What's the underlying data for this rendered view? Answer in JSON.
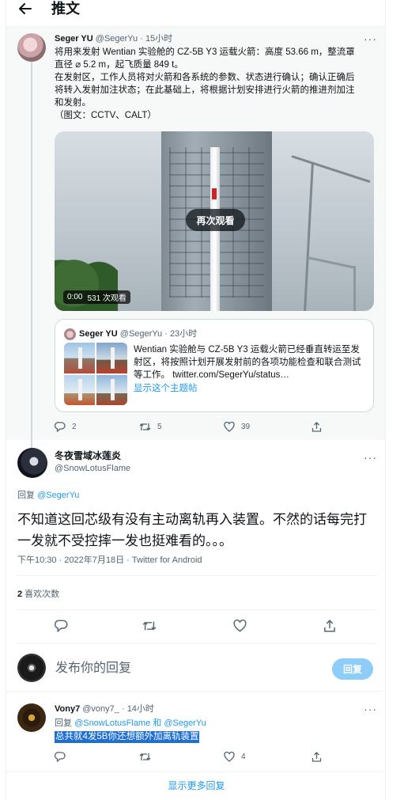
{
  "header": {
    "back_icon": "arrow-left-icon",
    "title": "推文"
  },
  "quoted_tweet": {
    "author_name": "Seger YU",
    "author_handle": "@SegerYu",
    "time": "· 15小时",
    "text_lines": [
      "将用来发射 Wentian 实验舱的 CZ-5B Y3 运载火箭：高度 53.66 m，整流罩",
      "直径 ⌀ 5.2 m，起飞质量 849 t。",
      "在发射区，工作人员将对火箭和各系统的参数、状态进行确认；确认正确后",
      "将转入发射加注状态；在此基础上，将根据计划安排进行火箭的推进剂加注",
      "和发射。",
      "（图文：CCTV、CALT）"
    ],
    "video": {
      "replay_label": "再次观看",
      "time": "0:00",
      "views": "531 次观看"
    },
    "inner_quote": {
      "author_name": "Seger YU",
      "author_handle": "@SegerYu",
      "time": "· 23小时",
      "text": "Wentian 实验舱与 CZ-5B Y3 运载火箭已经垂直转运至发射区，将按照计划开展发射前的各项功能检查和联合测试等工作。 twitter.com/SegerYu/status…",
      "show_thread": "显示这个主题帖"
    },
    "actions": {
      "reply_count": "2",
      "retweet_count": "5",
      "like_count": "39"
    }
  },
  "main_tweet": {
    "author_name": "冬夜雪域冰莲炎",
    "author_handle": "@SnowLotusFlame",
    "reply_prefix": "回复 ",
    "reply_to": "@SegerYu",
    "text": "不知道这回芯级有没有主动离轨再入装置。不然的话每完打一发就不受控摔一发也挺难看的。。。",
    "timestamp": "下午10:30 · 2022年7月18日 · Twitter for Android",
    "likes_count": "2",
    "likes_label": " 喜欢次数"
  },
  "reply_composer": {
    "placeholder": "发布你的回复",
    "button": "回复"
  },
  "reply_tweet": {
    "author_name": "Vony7",
    "author_handle": "@vony7_",
    "time": "· 14小时",
    "reply_prefix": "回复 ",
    "reply_to": "@SnowLotusFlame 和 @SegerYu",
    "text": "总共就4发5B你还想额外加离轨装置",
    "actions": {
      "like_count": "4"
    }
  },
  "footer": {
    "show_more": "显示更多回复"
  },
  "colors": {
    "accent": "#1d9bf0",
    "text": "#0f1419",
    "muted": "#536471",
    "selection": "#1f6fd1"
  }
}
